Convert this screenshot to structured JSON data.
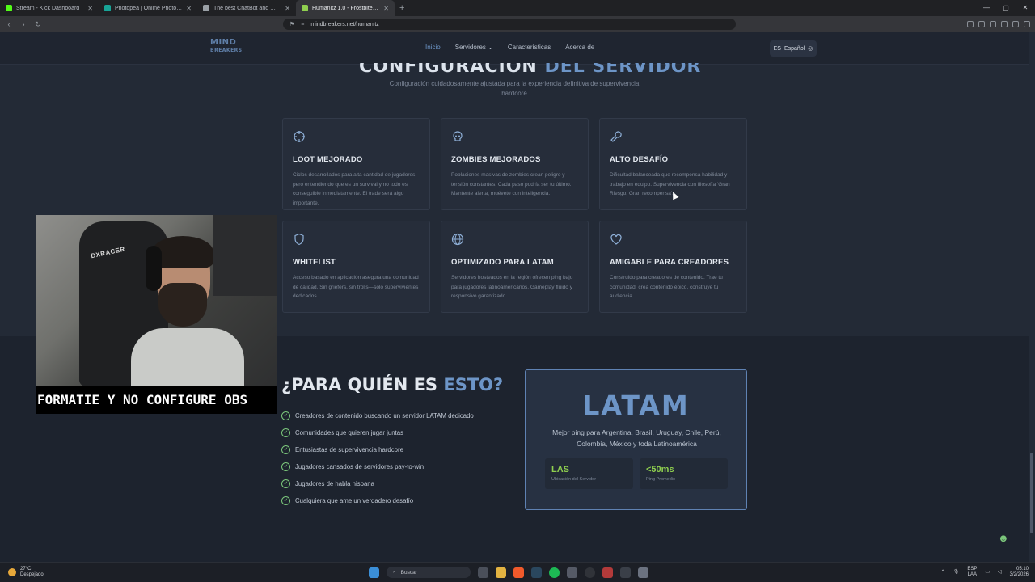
{
  "browser": {
    "tabs": [
      {
        "title": "Stream - Kick Dashboard",
        "color": "#53fc18",
        "active": false
      },
      {
        "title": "Photopea | Online Photo Editor",
        "color": "#18a497",
        "active": false
      },
      {
        "title": "The best ChatBot and Widgets for Tw...",
        "color": "#9aa0a6",
        "active": false
      },
      {
        "title": "Humanitz 1.0 - Frostbite - 06/03...",
        "color": "#8fcf4f",
        "active": true
      }
    ],
    "new_tab": "+",
    "url": "mindbreakers.net/humanitz"
  },
  "site": {
    "logo_line1": "MIND",
    "logo_line2": "BREAKERS",
    "nav": [
      {
        "label": "Inicio",
        "active": true
      },
      {
        "label": "Servidores ⌄",
        "active": false
      },
      {
        "label": "Características",
        "active": false
      },
      {
        "label": "Acerca de",
        "active": false
      }
    ],
    "language_code": "ES",
    "language": "Español",
    "section_title_main": "CONFIGURACIÓN ",
    "section_title_highlight": "DEL SERVIDOR",
    "section_subtitle": "Configuración cuidadosamente ajustada para la experiencia definitiva de supervivencia hardcore",
    "features": [
      {
        "icon": "crosshair-icon",
        "title": "LOOT MEJORADO",
        "desc": "Ciclos desarrollados para alta cantidad de jugadores pero entendiendo que es un survival y no todo es conseguible inmediatamente. El trade será algo importante."
      },
      {
        "icon": "skull-icon",
        "title": "ZOMBIES MEJORADOS",
        "desc": "Poblaciones masivas de zombies crean peligro y tensión constantes. Cada paso podría ser tu último. Mantente alerta, muévete con inteligencia."
      },
      {
        "icon": "wrench-icon",
        "title": "ALTO DESAFÍO",
        "desc": "Dificultad balanceada que recompensa habilidad y trabajo en equipo. Supervivencia con filosofía 'Gran Riesgo, Gran recompensa'."
      },
      {
        "icon": "shield-icon",
        "title": "WHITELIST",
        "desc": "Acceso basado en aplicación asegura una comunidad de calidad. Sin griefers, sin trolls—solo supervivientes dedicados."
      },
      {
        "icon": "globe-icon",
        "title": "OPTIMIZADO PARA LATAM",
        "desc": "Servidores hosteados en la región ofrecen ping bajo para jugadores latinoamericanos. Gameplay fluido y responsivo garantizado."
      },
      {
        "icon": "heart-icon",
        "title": "AMIGABLE PARA CREADORES",
        "desc": "Construido para creadores de contenido. Trae tu comunidad, crea contenido épico, construye tu audiencia."
      }
    ],
    "who_title_main": "¿PARA QUIÉN ES ",
    "who_title_highlight": "ESTO?",
    "who_list": [
      "Creadores de contenido buscando un servidor LATAM dedicado",
      "Comunidades que quieren jugar juntas",
      "Entusiastas de supervivencia hardcore",
      "Jugadores cansados de servidores pay-to-win",
      "Jugadores de habla hispana",
      "Cualquiera que ame un verdadero desafío"
    ],
    "latam_box": {
      "title": "LATAM",
      "desc": "Mejor ping para Argentina, Brasil, Uruguay, Chile, Perú, Colombia, México y toda Latinoamérica",
      "stat1_value": "LAS",
      "stat1_label": "Ubicación del Servidor",
      "stat2_value": "<50ms",
      "stat2_label": "Ping Promedio"
    }
  },
  "overlay": {
    "chair_brand": "DXRACER",
    "banner": "FORMATIE Y NO CONFIGURE OBS"
  },
  "taskbar": {
    "temp": "27°C",
    "weather": "Despejado",
    "search": "Buscar",
    "lang1": "ESP",
    "lang2": "LAA",
    "time": "05:10",
    "date": "3/2/2026"
  }
}
